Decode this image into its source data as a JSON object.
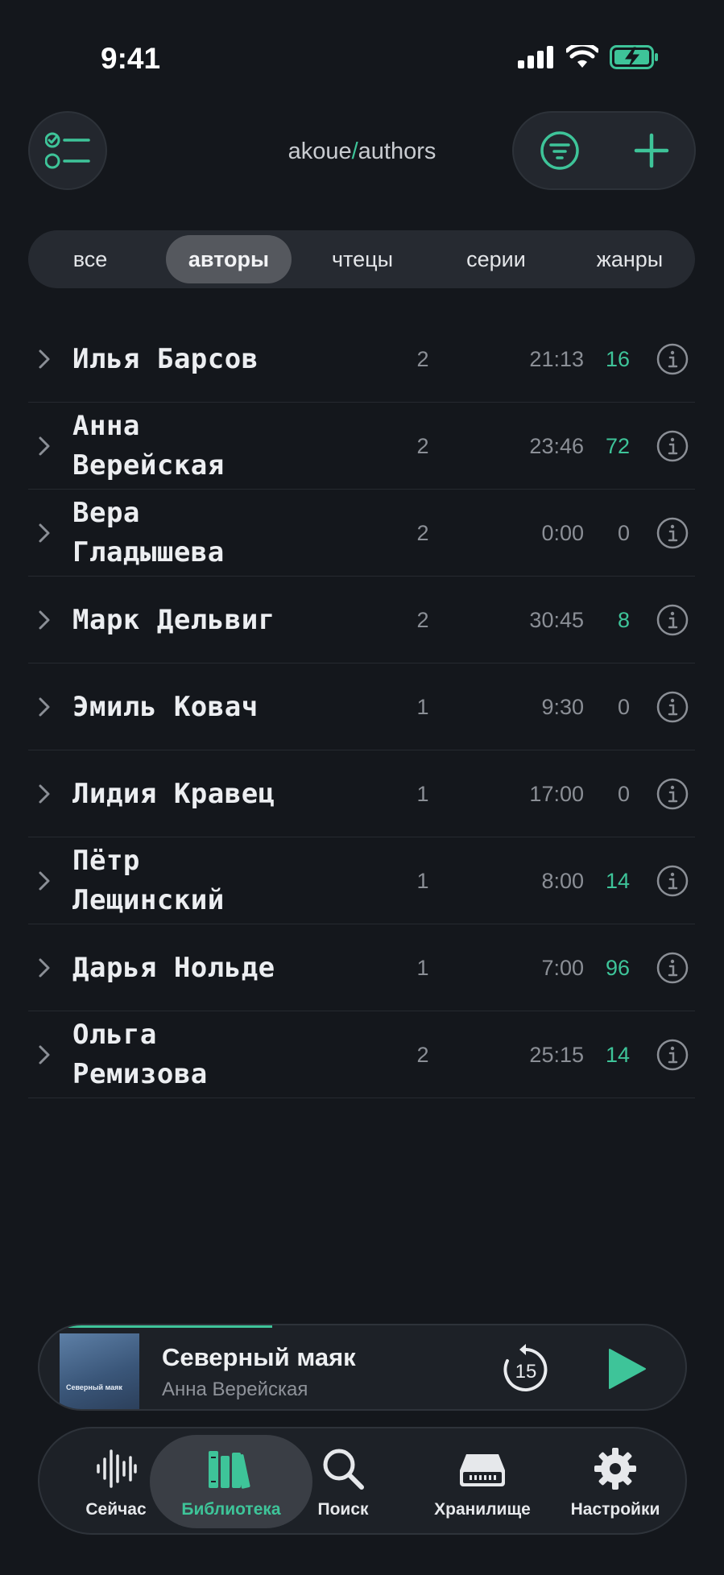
{
  "status_bar": {
    "time": "9:41"
  },
  "header": {
    "path_prefix": "akoue",
    "path_sep": "/",
    "path_suffix": "authors",
    "icons": {
      "left": "checklist-icon",
      "filter": "filter-icon",
      "add": "plus-icon"
    }
  },
  "segments": [
    {
      "label": "все",
      "active": false
    },
    {
      "label": "авторы",
      "active": true
    },
    {
      "label": "чтецы",
      "active": false
    },
    {
      "label": "серии",
      "active": false
    },
    {
      "label": "жанры",
      "active": false
    }
  ],
  "authors": [
    {
      "line1": "Илья Барсов",
      "line2": "",
      "books": "2",
      "duration": "21:13",
      "percent": "16",
      "highlight": true
    },
    {
      "line1": "Анна",
      "line2": "Верейская",
      "books": "2",
      "duration": "23:46",
      "percent": "72",
      "highlight": true
    },
    {
      "line1": "Вера",
      "line2": "Гладышева",
      "books": "2",
      "duration": "0:00",
      "percent": "0",
      "highlight": false
    },
    {
      "line1": "Марк Дельвиг",
      "line2": "",
      "books": "2",
      "duration": "30:45",
      "percent": "8",
      "highlight": true
    },
    {
      "line1": "Эмиль Ковач",
      "line2": "",
      "books": "1",
      "duration": "9:30",
      "percent": "0",
      "highlight": false
    },
    {
      "line1": "Лидия Кравец",
      "line2": "",
      "books": "1",
      "duration": "17:00",
      "percent": "0",
      "highlight": false
    },
    {
      "line1": "Пётр",
      "line2": "Лещинский",
      "books": "1",
      "duration": "8:00",
      "percent": "14",
      "highlight": true
    },
    {
      "line1": "Дарья Нольде",
      "line2": "",
      "books": "1",
      "duration": "7:00",
      "percent": "96",
      "highlight": true
    },
    {
      "line1": "Ольга",
      "line2": "Ремизова",
      "books": "2",
      "duration": "25:15",
      "percent": "14",
      "highlight": true
    }
  ],
  "mini_player": {
    "title": "Северный маяк",
    "author": "Анна Верейская",
    "cover_title": "Северный маяк",
    "rewind_seconds": "15",
    "progress": 0.36
  },
  "tabbar": [
    {
      "label": "Сейчас",
      "icon": "waveform-icon",
      "active": false
    },
    {
      "label": "Библиотека",
      "icon": "books-icon",
      "active": true
    },
    {
      "label": "Поиск",
      "icon": "search-icon",
      "active": false
    },
    {
      "label": "Хранилище",
      "icon": "storage-icon",
      "active": false
    },
    {
      "label": "Настройки",
      "icon": "gear-icon",
      "active": false
    }
  ],
  "colors": {
    "accent": "#3ec499",
    "background": "#14171c",
    "muted": "#8b8f96"
  }
}
